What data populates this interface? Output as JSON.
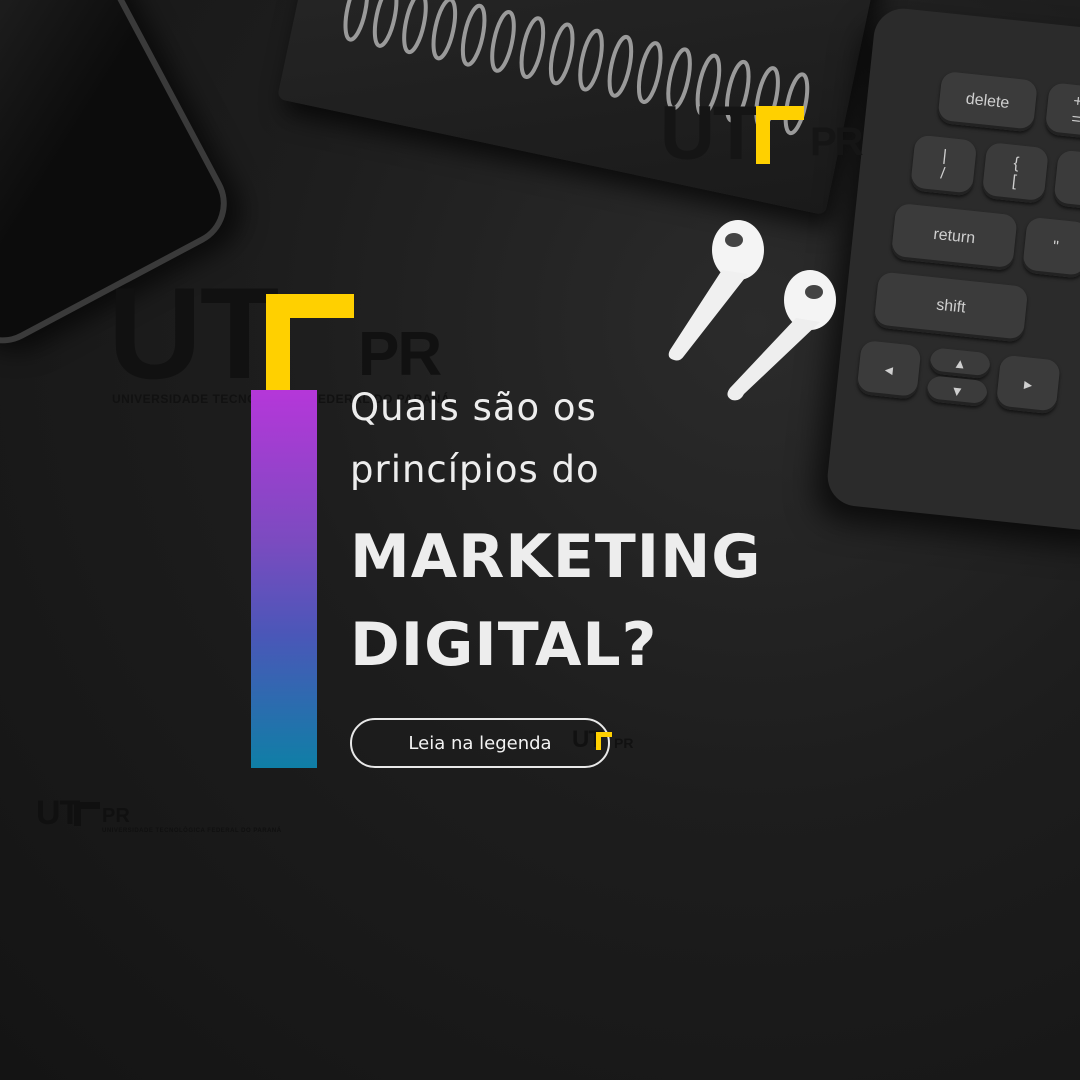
{
  "background": {
    "color": "#1c1c1c",
    "objects": [
      "smartphone",
      "spiral-notebook",
      "keyboard",
      "wireless-earbuds"
    ]
  },
  "keyboard": {
    "keys": {
      "delete": "delete",
      "plus": "+",
      "equals": "=",
      "pipe": "|",
      "backslash": "/",
      "brace": "{",
      "bracket": "[",
      "return": "return",
      "quote": "\"",
      "shift": "shift",
      "left": "◂",
      "up": "▴",
      "down": "▾",
      "right": "▸"
    }
  },
  "logos": {
    "main": {
      "u": "UT",
      "pr": "PR",
      "subtitle": "UNIVERSIDADE TECNOLÓGICA FEDERAL DO PARANÁ"
    },
    "colors": {
      "yellow": "#ffd000",
      "dark": "#121212"
    }
  },
  "headline": {
    "line1": "Quais são os",
    "line2": "princípios do",
    "line3": "MARKETING",
    "line4": "DIGITAL?"
  },
  "cta": {
    "label": "Leia na legenda"
  },
  "accent_gradient": [
    "#b537d9",
    "#7b4bc0",
    "#4a57b8",
    "#0f7fa6"
  ]
}
